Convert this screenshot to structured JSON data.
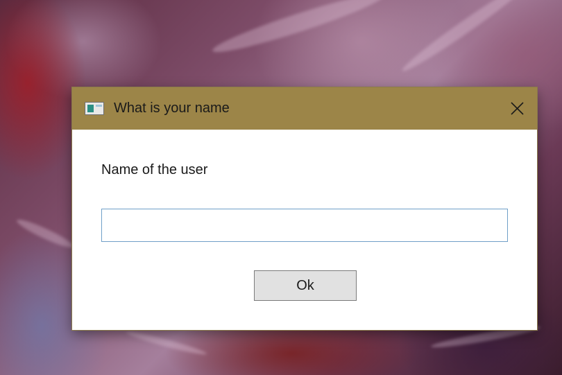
{
  "dialog": {
    "title": "What is your name",
    "title_bar_color": "#9c8548",
    "app_icon": "window-app-icon",
    "close_icon": "close-icon",
    "prompt_label": "Name of the user",
    "name_input": {
      "value": "",
      "placeholder": ""
    },
    "ok_label": "Ok"
  }
}
